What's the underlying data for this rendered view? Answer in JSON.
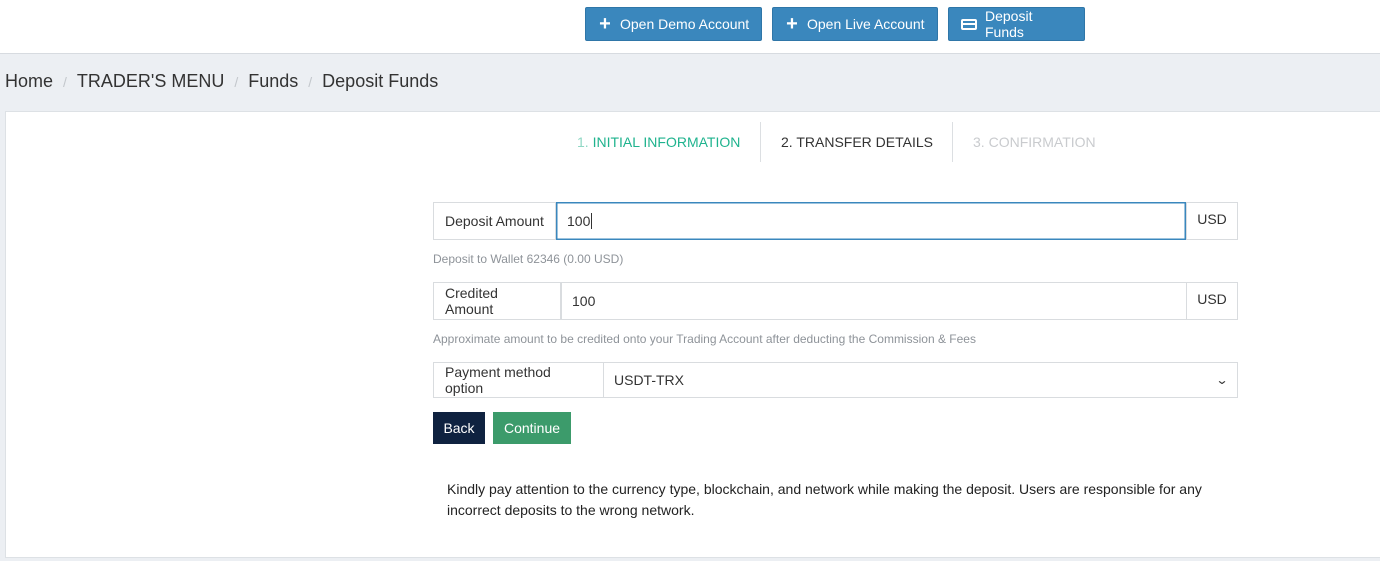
{
  "topbar": {
    "buttons": [
      {
        "label": "Open Demo Account",
        "icon": "plus-icon"
      },
      {
        "label": "Open Live Account",
        "icon": "plus-icon"
      },
      {
        "label": "Deposit Funds",
        "icon": "credit-card-icon"
      }
    ]
  },
  "breadcrumb": [
    "Home",
    "TRADER'S MENU",
    "Funds",
    "Deposit Funds"
  ],
  "steps": [
    {
      "num": "1.",
      "label": "INITIAL INFORMATION",
      "state": "completed"
    },
    {
      "num": "2.",
      "label": "TRANSFER DETAILS",
      "state": "active"
    },
    {
      "num": "3.",
      "label": "CONFIRMATION",
      "state": "disabled"
    }
  ],
  "form": {
    "deposit_label": "Deposit Amount",
    "deposit_value": "100",
    "deposit_unit": "USD",
    "deposit_help": "Deposit to Wallet 62346 (0.00 USD)",
    "credited_label": "Credited Amount",
    "credited_value": "100",
    "credited_unit": "USD",
    "credited_help": "Approximate amount to be credited onto your Trading Account after deducting the Commission & Fees",
    "payment_label": "Payment method option",
    "payment_value": "USDT-TRX"
  },
  "actions": {
    "back": "Back",
    "continue": "Continue"
  },
  "notice": "Kindly pay attention to the currency type, blockchain, and network while making the deposit. Users are responsible for any incorrect deposits to the wrong network.",
  "colors": {
    "primary": "#3a87bd",
    "success": "#3c9b6b",
    "dark": "#0f2240",
    "step_done": "#1fb38e"
  }
}
